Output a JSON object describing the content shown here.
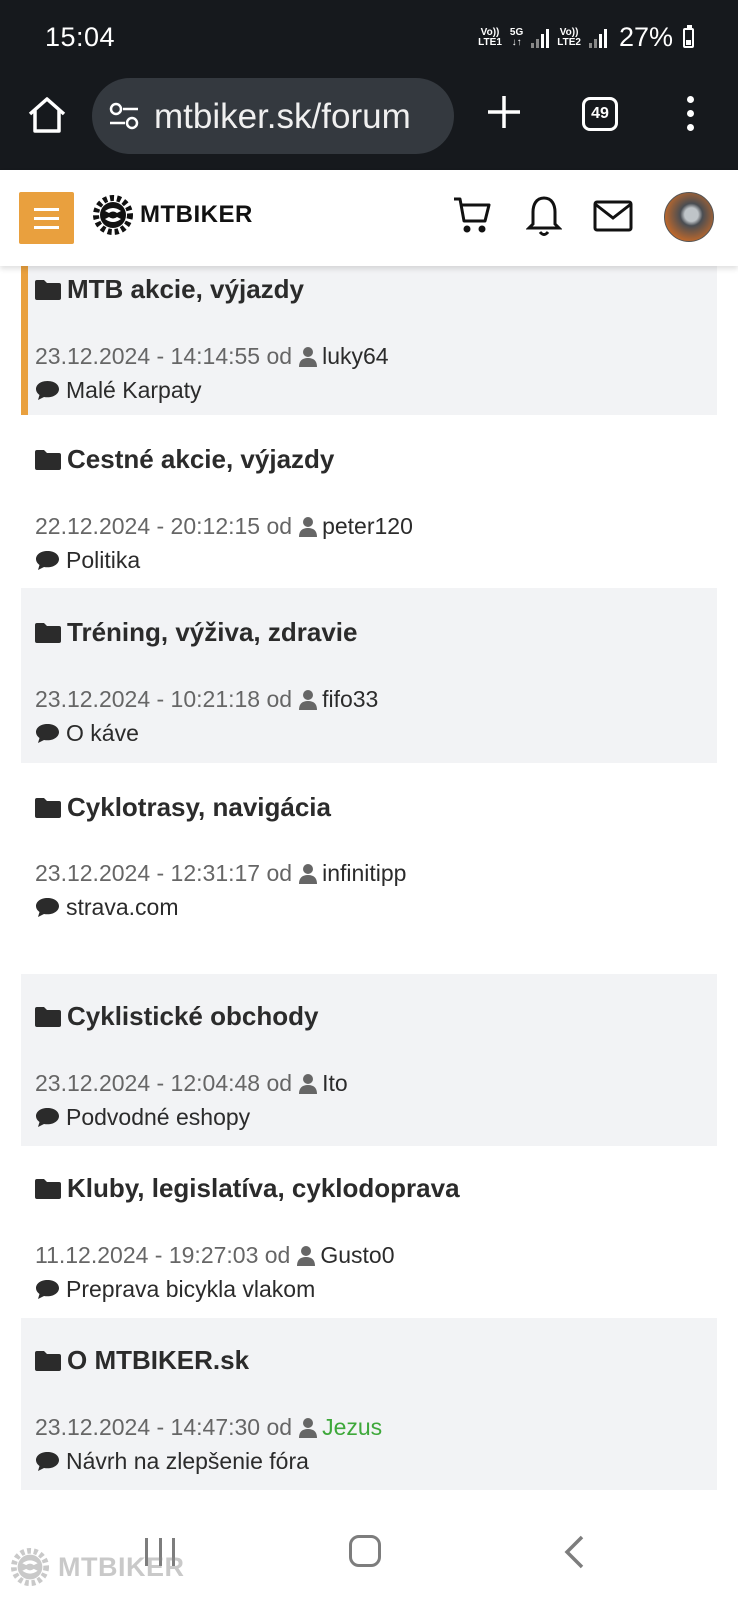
{
  "status_bar": {
    "time": "15:04",
    "net1_top": "Vo))",
    "net1_bottom": "LTE1",
    "net_5g_top": "5G",
    "net_5g_bottom": "↓↑",
    "net2_top": "Vo))",
    "net2_bottom": "LTE2",
    "battery": "27%"
  },
  "browser": {
    "url": "mtbiker.sk/forum",
    "tab_count": "49",
    "icons": [
      "home-icon",
      "site-settings-icon",
      "new-tab-icon",
      "tab-switcher-icon",
      "more-vert-icon"
    ]
  },
  "header": {
    "logo_text": "MTBIKER",
    "icons": [
      "menu-icon",
      "cart-icon",
      "bell-icon",
      "mail-icon",
      "avatar"
    ],
    "accent_color": "#e9a03e"
  },
  "forums": [
    {
      "title": "MTB akcie, výjazdy",
      "date": "23.12.2024 - 14:14:55",
      "od": "od",
      "user": "luky64",
      "last_topic": "Malé Karpaty"
    },
    {
      "title": "Cestné akcie, výjazdy",
      "date": "22.12.2024 - 20:12:15",
      "od": "od",
      "user": "peter120",
      "last_topic": "Politika"
    },
    {
      "title": "Tréning, výživa, zdravie",
      "date": "23.12.2024 - 10:21:18",
      "od": "od",
      "user": "fifo33",
      "last_topic": "O káve"
    },
    {
      "title": "Cyklotrasy, navigácia",
      "date": "23.12.2024 - 12:31:17",
      "od": "od",
      "user": "infinitipp",
      "last_topic": "strava.com"
    },
    {
      "title": "Cyklistické obchody",
      "date": "23.12.2024 - 12:04:48",
      "od": "od",
      "user": "Ito",
      "last_topic": "Podvodné eshopy"
    },
    {
      "title": "Kluby, legislatíva, cyklodoprava",
      "date": "11.12.2024 - 19:27:03",
      "od": "od",
      "user": "Gusto0",
      "last_topic": "Preprava bicykla vlakom"
    },
    {
      "title": "O MTBIKER.sk",
      "date": "23.12.2024 - 14:47:30",
      "od": "od",
      "user": "Jezus",
      "last_topic": "Návrh na zlepšenie fóra",
      "user_color": "#3ea83a"
    }
  ],
  "watermark": "MTBIKER"
}
